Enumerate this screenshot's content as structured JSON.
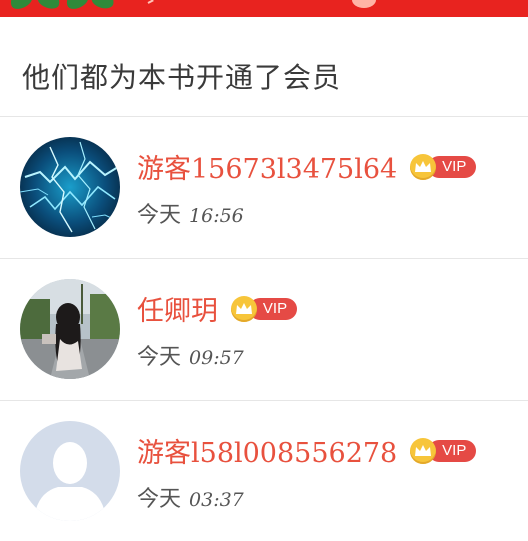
{
  "section": {
    "title": "他们都为本书开通了会员"
  },
  "members": [
    {
      "name": "游客15673l3475l64",
      "badge": "VIP",
      "day": "今天",
      "time": "16:56",
      "avatar": "lightning-avatar"
    },
    {
      "name": "任卿玥",
      "badge": "VIP",
      "day": "今天",
      "time": "09:57",
      "avatar": "photo-avatar"
    },
    {
      "name": "游客l58l008556278",
      "badge": "VIP",
      "day": "今天",
      "time": "03:37",
      "avatar": "default-avatar"
    }
  ],
  "colors": {
    "banner": "#e8231f",
    "name": "#e8513e",
    "vip_pill": "#e54a45",
    "crown": "#f7c53a"
  }
}
